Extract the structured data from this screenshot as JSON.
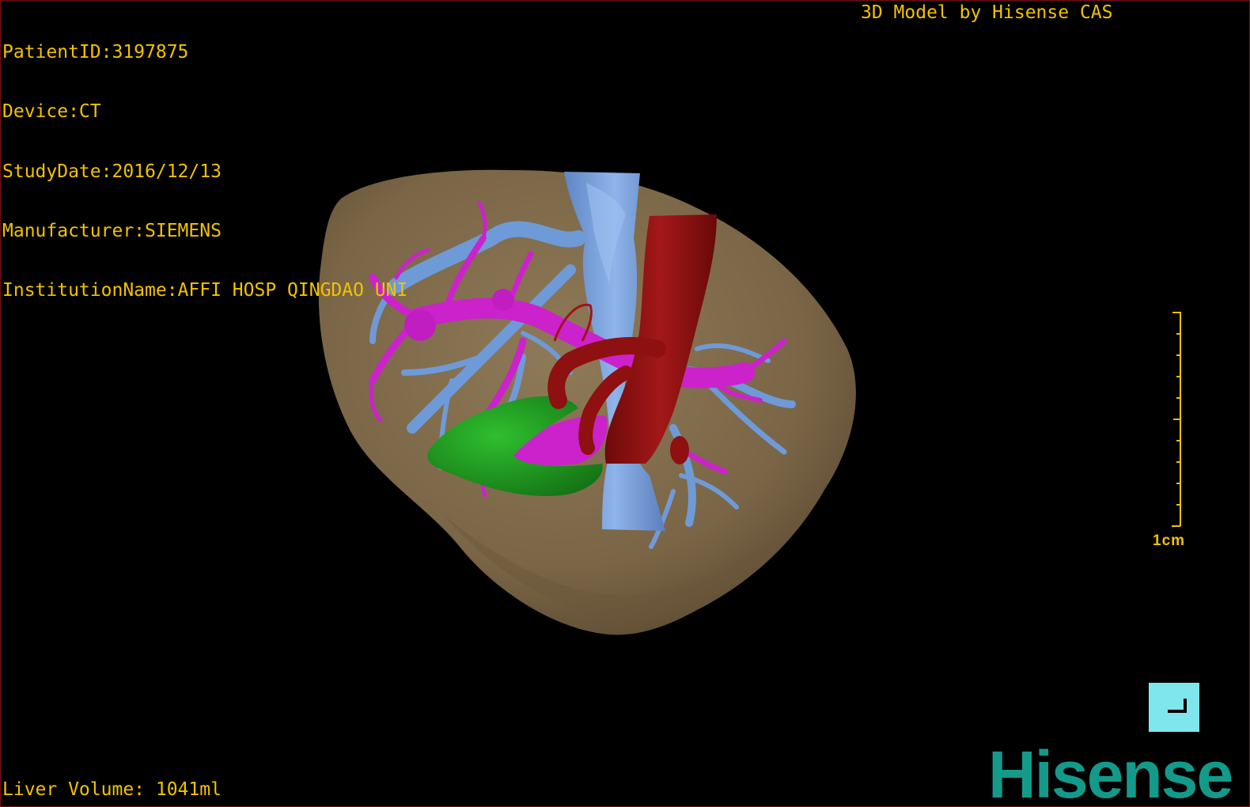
{
  "patient": {
    "id_line": "PatientID:3197875",
    "device_line": "Device:CT",
    "study_date_line": "StudyDate:2016/12/13",
    "manufacturer_line": "Manufacturer:SIEMENS",
    "institution_line": "InstitutionName:AFFI HOSP QINGDAO UNI"
  },
  "header": {
    "model_credit": "3D Model by Hisense CAS"
  },
  "footer": {
    "liver_volume": "Liver Volume: 1041ml"
  },
  "scale": {
    "label": "1cm"
  },
  "brand": {
    "logo_text": "Hisense"
  },
  "controls": {
    "view_button_icon": "corner-view-icon"
  },
  "colors": {
    "overlay_text": "#f2c200",
    "background": "#000000",
    "frame_border": "#7a1010",
    "liver": "#7d6849",
    "hepatic_vein": "#6f9ad8",
    "portal_vein": "#cc22cc",
    "artery": "#8e1010",
    "tumor": "#1f9a1f",
    "view_button": "#7fe6ee",
    "brand": "#139a8a"
  },
  "model_parts": [
    "liver",
    "hepatic-vein",
    "portal-vein",
    "artery",
    "tumor"
  ]
}
